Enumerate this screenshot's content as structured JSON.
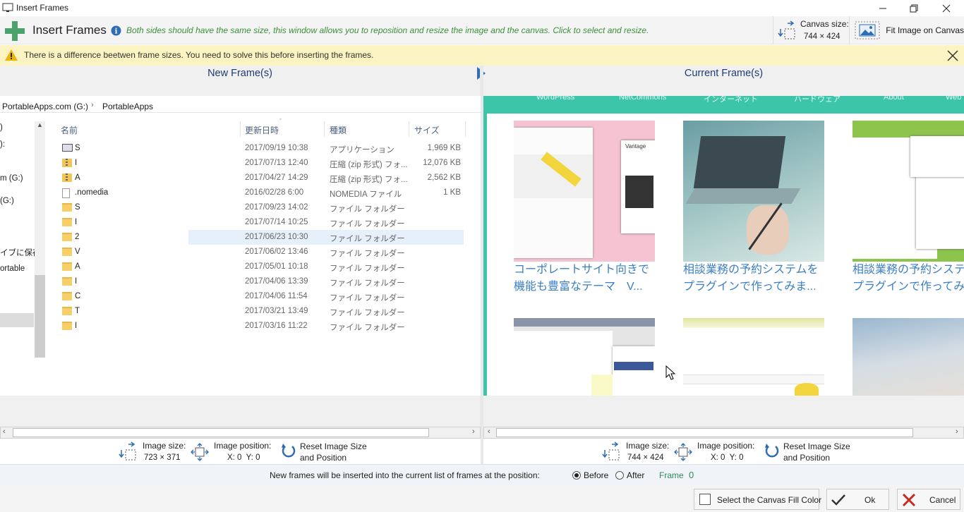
{
  "window": {
    "title": "Insert Frames"
  },
  "header": {
    "title": "Insert Frames",
    "info": "Both sides should have the same size, this window allows you to reposition and resize the image and the canvas. Click to select and resize.",
    "canvas_size_label": "Canvas size:",
    "canvas_size_value": "744 × 424",
    "fit_label": "Fit Image on Canvas"
  },
  "warning": {
    "text": "There is a difference beetwen frame sizes. You need to solve this before inserting the frames."
  },
  "panels": {
    "new_title": "New Frame(s)",
    "current_title": "Current Frame(s)"
  },
  "explorer": {
    "breadcrumb": [
      "PortableApps.com (G:)",
      "PortableApps"
    ],
    "columns": [
      "名前",
      "更新日時",
      "種類",
      "サイズ"
    ],
    "nav_items": [
      ")",
      "):",
      "m (G:)",
      "(G:)",
      "イブに保存",
      "ortable"
    ],
    "rows": [
      {
        "name": "S",
        "date": "2017/09/19 10:38",
        "type": "アプリケーション",
        "size": "1,969 KB",
        "icon": "app"
      },
      {
        "name": "I",
        "date": "2017/07/13 12:40",
        "type": "圧縮 (zip 形式) フォ...",
        "size": "12,076 KB",
        "icon": "zip"
      },
      {
        "name": "A",
        "date": "2017/04/27 14:29",
        "type": "圧縮 (zip 形式) フォ...",
        "size": "2,562 KB",
        "icon": "zip"
      },
      {
        "name": ".nomedia",
        "date": "2016/02/28 6:00",
        "type": "NOMEDIA ファイル",
        "size": "1 KB",
        "icon": "doc"
      },
      {
        "name": "S",
        "date": "2017/09/23 14:02",
        "type": "ファイル フォルダー",
        "size": "",
        "icon": "folder"
      },
      {
        "name": "I",
        "date": "2017/07/14 10:25",
        "type": "ファイル フォルダー",
        "size": "",
        "icon": "folder"
      },
      {
        "name": "2",
        "date": "2017/06/23 10:30",
        "type": "ファイル フォルダー",
        "size": "",
        "icon": "folder"
      },
      {
        "name": "V",
        "date": "2017/06/02 13:46",
        "type": "ファイル フォルダー",
        "size": "",
        "icon": "folder"
      },
      {
        "name": "A",
        "date": "2017/05/01 10:18",
        "type": "ファイル フォルダー",
        "size": "",
        "icon": "folder"
      },
      {
        "name": "I",
        "date": "2017/04/06 13:39",
        "type": "ファイル フォルダー",
        "size": "",
        "icon": "folder"
      },
      {
        "name": "C",
        "date": "2017/04/06 11:54",
        "type": "ファイル フォルダー",
        "size": "",
        "icon": "folder"
      },
      {
        "name": "T",
        "date": "2017/03/21 13:49",
        "type": "ファイル フォルダー",
        "size": "",
        "icon": "folder"
      },
      {
        "name": "I",
        "date": "2017/03/16 11:22",
        "type": "ファイル フォルダー",
        "size": "",
        "icon": "folder"
      }
    ]
  },
  "preview": {
    "nav": [
      "WordPress",
      "NetCommons",
      "インターネット",
      "ハードウェア",
      "About",
      "Web"
    ],
    "cards": [
      {
        "title_line1": "コーポレートサイト向きで",
        "title_line2": "機能も豊富なテーマ　V..."
      },
      {
        "title_line1": "相談業務の予約システムを",
        "title_line2": "プラグインで作ってみま..."
      },
      {
        "title_line1": "相談業務の予約システ",
        "title_line2": "プラグインで作ってみ"
      }
    ]
  },
  "left_controls": {
    "image_size_label": "Image size:",
    "image_size_value": "723 × 371",
    "image_position_label": "Image position:",
    "image_position_value": "X: 0  Y: 0",
    "reset_label_1": "Reset Image Size",
    "reset_label_2": "and Position"
  },
  "right_controls": {
    "image_size_label": "Image size:",
    "image_size_value": "744 × 424",
    "image_position_label": "Image position:",
    "image_position_value": "X: 0  Y: 0",
    "reset_label_1": "Reset Image Size",
    "reset_label_2": "and Position"
  },
  "insert": {
    "text": "New frames will be inserted into the current list of frames at the position:",
    "before": "Before",
    "after": "After",
    "frame_label": "Frame",
    "frame_value": "0"
  },
  "footer": {
    "fill_color": "Select the Canvas Fill Color",
    "ok": "Ok",
    "cancel": "Cancel"
  }
}
